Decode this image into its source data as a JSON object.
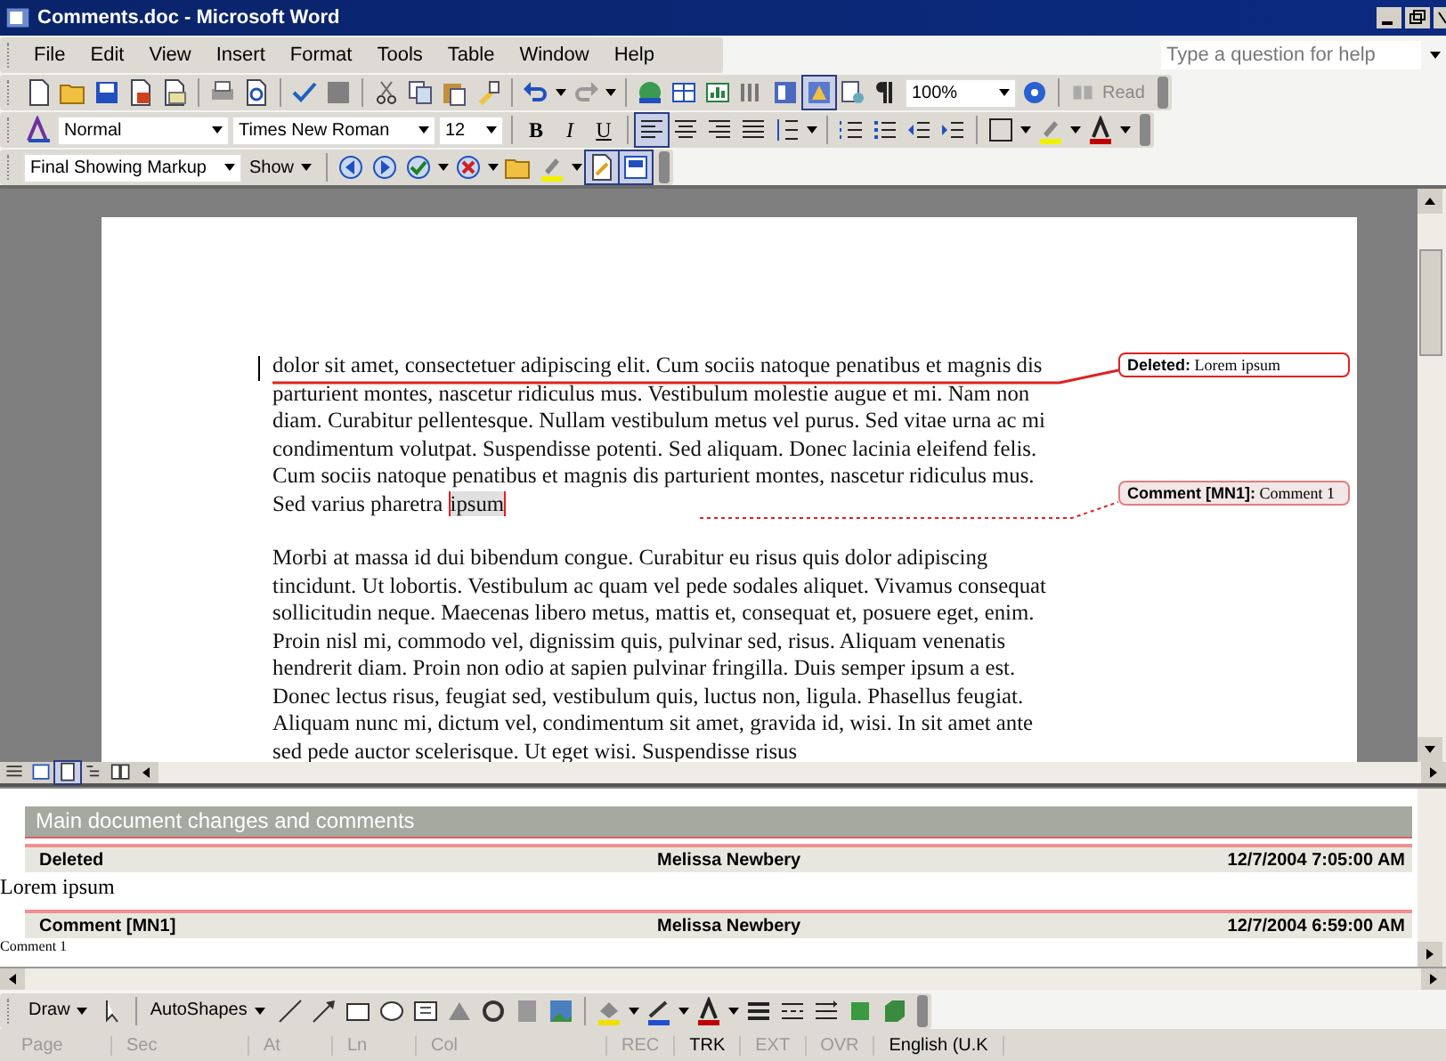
{
  "window": {
    "title": "Comments.doc - Microsoft Word"
  },
  "menu": [
    "File",
    "Edit",
    "View",
    "Insert",
    "Format",
    "Tools",
    "Table",
    "Window",
    "Help"
  ],
  "help_box": {
    "placeholder": "Type a question for help"
  },
  "standard_toolbar": {
    "zoom": "100%",
    "read": "Read",
    "document_map_on": true
  },
  "formatting_toolbar": {
    "style": "Normal",
    "font": "Times New Roman",
    "size": "12",
    "bold": "B",
    "italic": "I",
    "underline": "U",
    "alignment": [
      {
        "selected": true
      },
      {
        "selected": false
      },
      {
        "selected": false
      },
      {
        "selected": false
      }
    ]
  },
  "reviewing_toolbar": {
    "display": "Final Showing Markup",
    "show": "Show",
    "track_changes_on": true,
    "reviewing_pane_on": true
  },
  "document": {
    "paragraphs": [
      {
        "text": "dolor sit amet, consectetuer adipiscing elit. Cum sociis natoque penatibus et magnis dis parturient montes, nascetur ridiculus mus. Vestibulum molestie augue et mi. Nam non diam. Curabitur pellentesque. Nullam vestibulum metus vel purus. Sed vitae urna ac mi condimentum volutpat. Suspendisse potenti. Sed aliquam. Donec lacinia eleifend felis. Cum sociis natoque penatibus et magnis dis parturient montes, nascetur ridiculus mus. Sed varius pharetra ",
        "comment_anchor": "ipsum"
      },
      {
        "text": "Morbi at massa id dui bibendum congue. Curabitur eu risus quis dolor adipiscing tincidunt. Ut lobortis. Vestibulum ac quam vel pede sodales aliquet. Vivamus consequat sollicitudin neque. Maecenas libero metus, mattis et, consequat et, posuere eget, enim. Proin nisl mi, commodo vel, dignissim quis, pulvinar sed, risus. Aliquam venenatis hendrerit diam. Proin non odio at sapien pulvinar fringilla. Duis semper ipsum a est. Donec lectus risus, feugiat sed, vestibulum quis, luctus non, ligula. Phasellus feugiat. Aliquam nunc mi, dictum vel, condimentum sit amet, gravida id, wisi. In sit amet ante sed pede auctor scelerisque. Ut eget wisi. Suspendisse risus"
      }
    ],
    "balloons": [
      {
        "kind": "deleted",
        "label": "Deleted:",
        "text": "Lorem ipsum"
      },
      {
        "kind": "comment",
        "label": "Comment [MN1]:",
        "text": "Comment 1"
      }
    ]
  },
  "view_buttons": [
    {
      "selected": false
    },
    {
      "selected": false
    },
    {
      "selected": true
    },
    {
      "selected": false
    },
    {
      "selected": false
    }
  ],
  "reviewing_pane": {
    "title": "Main document changes and comments",
    "entries": [
      {
        "kind": "deletion",
        "type": "Deleted",
        "author": "Melissa Newbery",
        "date": "12/7/2004 7:05:00 AM",
        "body": "Lorem ipsum"
      },
      {
        "kind": "comment",
        "type": "Comment [MN1]",
        "author": "Melissa Newbery",
        "date": "12/7/2004 6:59:00 AM",
        "body": "Comment 1"
      }
    ]
  },
  "drawing_toolbar": {
    "draw": "Draw",
    "autoshapes": "AutoShapes"
  },
  "status_bar": [
    {
      "label": "Page",
      "active": false
    },
    {
      "label": "Sec",
      "active": false
    },
    {
      "label": "At",
      "active": false
    },
    {
      "label": "Ln",
      "active": false
    },
    {
      "label": "Col",
      "active": false
    },
    {
      "label": "REC",
      "active": false
    },
    {
      "label": "TRK",
      "active": true
    },
    {
      "label": "EXT",
      "active": false
    },
    {
      "label": "OVR",
      "active": false
    },
    {
      "label": "English (U.K",
      "active": true
    }
  ]
}
